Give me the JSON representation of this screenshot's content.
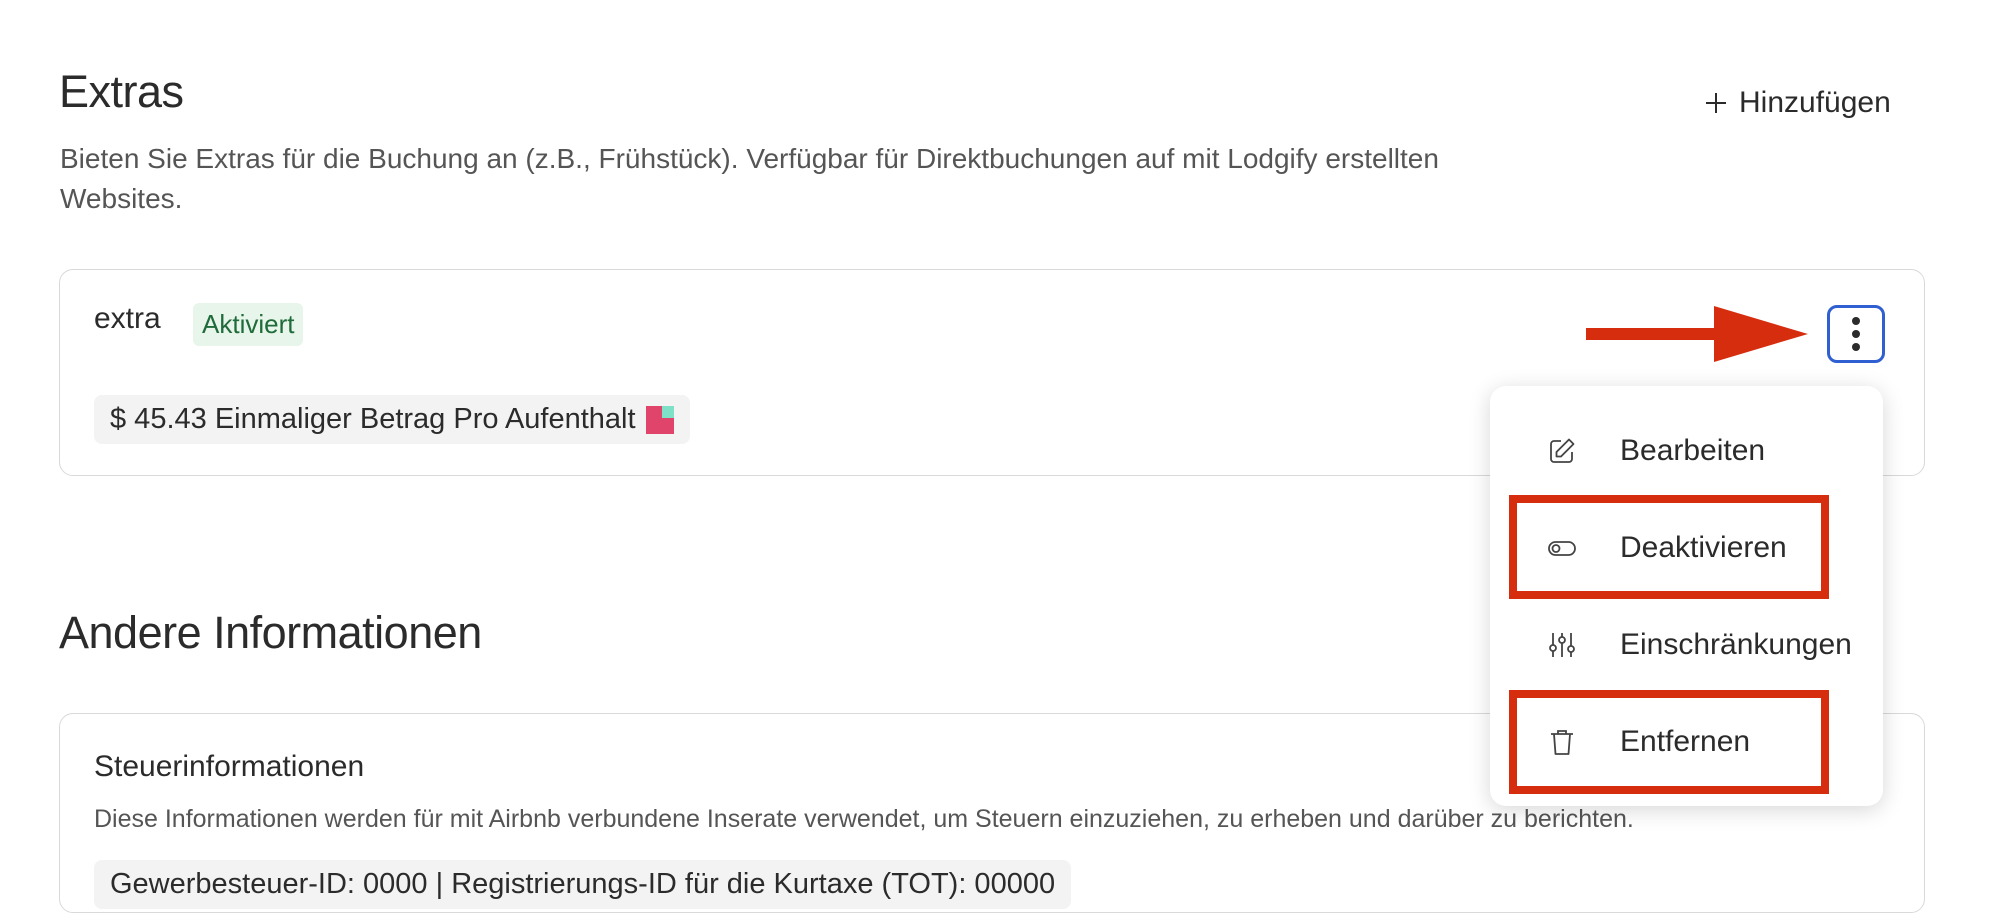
{
  "extras": {
    "title": "Extras",
    "description_line1": "Bieten Sie Extras für die Buchung an (z.B., Frühstück). Verfügbar für Direktbuchungen auf mit Lodgify erstellten",
    "description_line2": "Websites.",
    "add_label": "Hinzufügen",
    "item": {
      "name": "extra",
      "status": "Aktiviert",
      "price": "$ 45.43 Einmaliger Betrag Pro Aufenthalt"
    }
  },
  "menu": {
    "items": [
      {
        "label": "Bearbeiten",
        "icon": "edit-icon"
      },
      {
        "label": "Deaktivieren",
        "icon": "toggle-icon"
      },
      {
        "label": "Einschränkungen",
        "icon": "sliders-icon"
      },
      {
        "label": "Entfernen",
        "icon": "trash-icon"
      }
    ]
  },
  "other": {
    "title": "Andere Informationen",
    "tax": {
      "title": "Steuerinformationen",
      "description": "Diese Informationen werden für mit Airbnb verbundene Inserate verwendet, um Steuern einzuziehen, zu erheben und darüber zu berichten.",
      "chip": "Gewerbesteuer-ID: 0000 | Registrierungs-ID für die Kurtaxe (TOT): 00000"
    }
  },
  "colors": {
    "annotation_red": "#d72d0f",
    "focus_blue": "#2f5fd0",
    "badge_green_bg": "#e7f5ea",
    "badge_green_text": "#1f6b3a"
  }
}
